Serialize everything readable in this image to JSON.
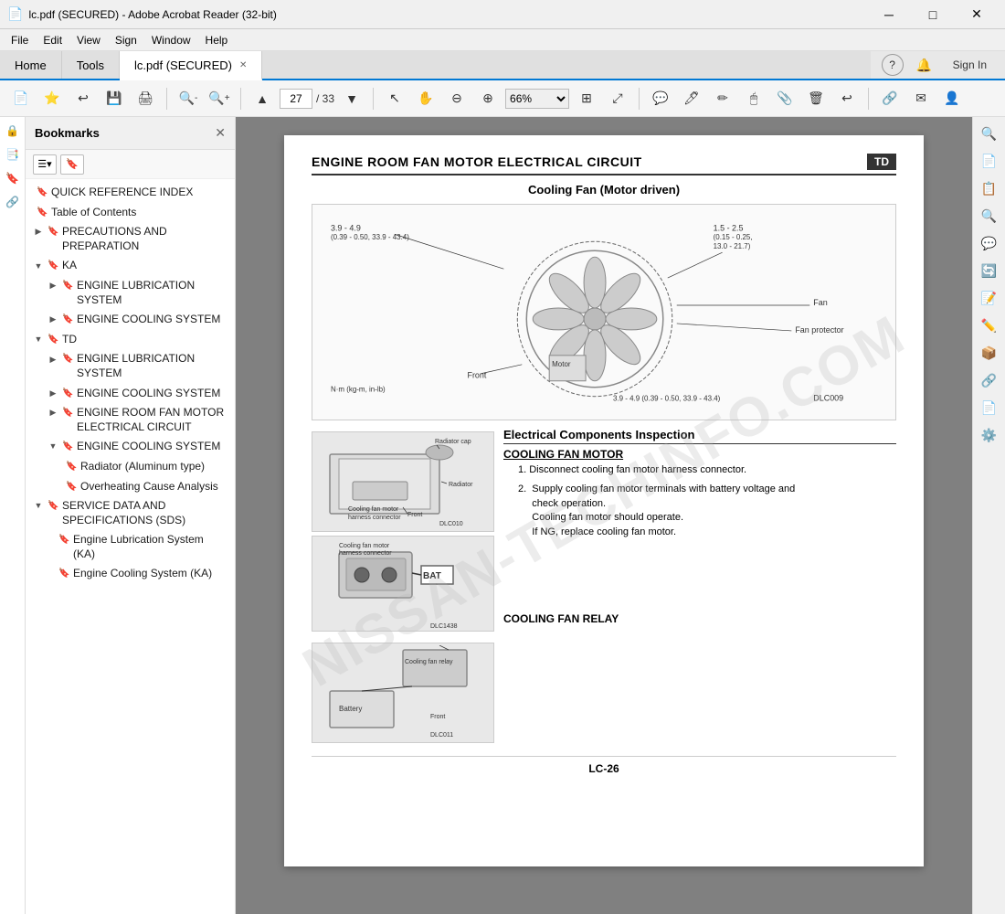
{
  "titlebar": {
    "title": "lc.pdf (SECURED) - Adobe Acrobat Reader (32-bit)",
    "icon": "📄"
  },
  "menubar": {
    "items": [
      "File",
      "Edit",
      "View",
      "Sign",
      "Window",
      "Help"
    ]
  },
  "tabs": [
    {
      "label": "Home",
      "active": false
    },
    {
      "label": "Tools",
      "active": false
    },
    {
      "label": "lc.pdf (SECURED)",
      "active": true
    }
  ],
  "toolbar": {
    "page_current": "27",
    "page_total": "33",
    "zoom": "66%"
  },
  "sidebar": {
    "title": "Bookmarks",
    "items": [
      {
        "id": "quick-ref",
        "label": "QUICK REFERENCE INDEX",
        "level": 0,
        "expandable": false,
        "expanded": false
      },
      {
        "id": "toc",
        "label": "Table of Contents",
        "level": 0,
        "expandable": false,
        "expanded": false
      },
      {
        "id": "precautions",
        "label": "PRECAUTIONS AND PREPARATION",
        "level": 0,
        "expandable": true,
        "expanded": false
      },
      {
        "id": "ka",
        "label": "KA",
        "level": 0,
        "expandable": true,
        "expanded": true
      },
      {
        "id": "ka-lubrication",
        "label": "ENGINE LUBRICATION SYSTEM",
        "level": 1,
        "expandable": true,
        "expanded": false
      },
      {
        "id": "ka-cooling",
        "label": "ENGINE COOLING SYSTEM",
        "level": 1,
        "expandable": true,
        "expanded": false
      },
      {
        "id": "td",
        "label": "TD",
        "level": 0,
        "expandable": true,
        "expanded": true
      },
      {
        "id": "td-lubrication",
        "label": "ENGINE LUBRICATION SYSTEM",
        "level": 1,
        "expandable": true,
        "expanded": false
      },
      {
        "id": "td-cooling",
        "label": "ENGINE COOLING SYSTEM",
        "level": 1,
        "expandable": true,
        "expanded": false
      },
      {
        "id": "td-fan-motor",
        "label": "ENGINE ROOM FAN MOTOR ELECTRICAL CIRCUIT",
        "level": 1,
        "expandable": true,
        "expanded": false
      },
      {
        "id": "td-cooling-system",
        "label": "ENGINE COOLING SYSTEM",
        "level": 1,
        "expandable": true,
        "expanded": true
      },
      {
        "id": "td-radiator",
        "label": "Radiator (Aluminum type)",
        "level": 2,
        "expandable": false,
        "expanded": false
      },
      {
        "id": "td-overheat",
        "label": "Overheating Cause Analysis",
        "level": 2,
        "expandable": false,
        "expanded": false
      },
      {
        "id": "sds",
        "label": "SERVICE DATA AND SPECIFICATIONS (SDS)",
        "level": 0,
        "expandable": true,
        "expanded": true
      },
      {
        "id": "sds-lubrication",
        "label": "Engine Lubrication System (KA)",
        "level": 2,
        "expandable": false,
        "expanded": false
      },
      {
        "id": "sds-cooling",
        "label": "Engine Cooling System (KA)",
        "level": 2,
        "expandable": false,
        "expanded": false
      }
    ]
  },
  "pdf": {
    "page_header_title": "ENGINE ROOM FAN MOTOR ELECTRICAL CIRCUIT",
    "page_badge": "TD",
    "section_subtitle": "Cooling Fan (Motor driven)",
    "fan_labels": {
      "torque1": "3.9 - 4.9",
      "torque1_sub": "(0.39 - 0.50, 33.9 - 43.4)",
      "torque2": "1.5 - 2.5",
      "torque2_sub": "(0.15 - 0.25,",
      "torque2_sub2": "13.0 - 21.7)",
      "torque3": "3.9 - 4.9 (0.39 - 0.50, 33.9 - 43.4)",
      "unit": "N·m (kg-m, in-lb)",
      "fan_label": "Fan",
      "fan_protector": "Fan protector",
      "motor_label": "Motor",
      "front_label": "Front",
      "diagram_id": "DLC009"
    },
    "electrical_title": "Electrical Components Inspection",
    "cooling_fan_motor": {
      "title": "COOLING FAN MOTOR",
      "steps": [
        "1.  Disconnect cooling fan motor harness connector.",
        "2.  Supply cooling fan motor terminals with battery voltage and check operation.\n    Cooling fan motor should operate.\n    If NG, replace cooling fan motor."
      ],
      "diagram1_id": "DLC010",
      "diagram2_id": "DLC1438",
      "labels": {
        "radiator_cap": "Radiator cap",
        "radiator": "Radiator",
        "harness_connector": "Cooling fan motor harness connector",
        "front": "Front",
        "motor_harness": "Cooling fan motor harness connector",
        "bat": "BAT"
      }
    },
    "cooling_fan_relay": {
      "title": "COOLING FAN RELAY",
      "diagram_id": "DLC011",
      "labels": {
        "relay": "Cooling fan relay",
        "battery": "Battery",
        "front": "Front"
      }
    },
    "page_number": "LC-26",
    "watermark": "NISSAN-TECHINFO.COM"
  },
  "right_tools": [
    "🔍",
    "📄",
    "📋",
    "🔍",
    "💬",
    "🔄",
    "📝",
    "✏️",
    "📦",
    "🔗",
    "🖨️",
    "⚙️"
  ],
  "left_icons": [
    "🔒",
    "📑",
    "🔖",
    "🔗"
  ]
}
